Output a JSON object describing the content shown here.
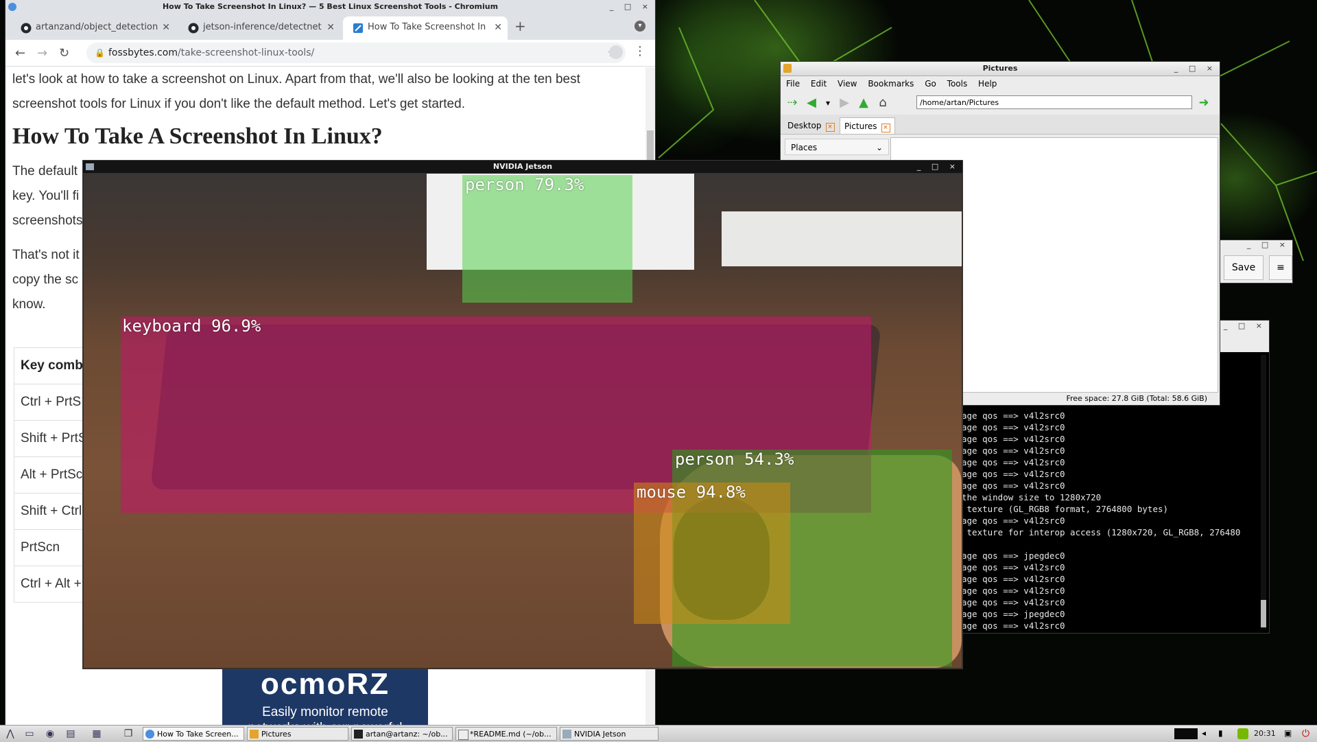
{
  "chromium": {
    "window_title": "How To Take Screenshot In Linux? — 5 Best Linux Screenshot Tools - Chromium",
    "tabs": [
      {
        "label": "artanzand/object_detection",
        "active": false
      },
      {
        "label": "jetson-inference/detectnet",
        "active": false
      },
      {
        "label": "How To Take Screenshot In",
        "active": true
      }
    ],
    "url_domain": "fossbytes.com",
    "url_path": "/take-screenshot-linux-tools/",
    "article": {
      "paragraph1": "let's look at how to take a screenshot on Linux. Apart from that, we'll also be looking at the ten best screenshot tools for Linux if you don't like the default method. Let's get started.",
      "heading": "How To Take A Screenshot In Linux?",
      "paragraph2_fragments": [
        "The default",
        "key. You'll fi",
        "screenshots"
      ],
      "paragraph3_fragments": [
        "That's not it",
        "copy the sc",
        "know."
      ],
      "table_header": "Key comb",
      "table_rows": [
        "Ctrl + PrtS",
        "Shift + PrtS",
        "Alt + PrtSc",
        "Shift + Ctrl",
        "PrtScn",
        "Ctrl + Alt +"
      ]
    },
    "ad": {
      "brand": "ocmoRZ",
      "line1": "Easily monitor remote",
      "line2": "networks with our powerful"
    }
  },
  "pictures": {
    "window_title": "Pictures",
    "menu": [
      "File",
      "Edit",
      "View",
      "Bookmarks",
      "Go",
      "Tools",
      "Help"
    ],
    "path": "/home/artan/Pictures",
    "tabs": [
      {
        "label": "Desktop"
      },
      {
        "label": "Pictures"
      }
    ],
    "places_label": "Places",
    "status": "Free space: 27.8 GiB (Total: 58.6 GiB)"
  },
  "editor": {
    "save_label": "Save",
    "menu_label": "≡"
  },
  "terminal": {
    "lines": [
      "age qos ==> v4l2src0",
      "age qos ==> v4l2src0",
      "age qos ==> v4l2src0",
      "age qos ==> v4l2src0",
      "age qos ==> v4l2src0",
      "age qos ==> v4l2src0",
      "age qos ==> v4l2src0",
      "the window size to 1280x720",
      " texture (GL_RGB8 format, 2764800 bytes)",
      "age qos ==> v4l2src0",
      " texture for interop access (1280x720, GL_RGB8, 276480",
      "",
      "age qos ==> jpegdec0",
      "age qos ==> v4l2src0",
      "age qos ==> v4l2src0",
      "age qos ==> v4l2src0",
      "age qos ==> v4l2src0",
      "age qos ==> jpegdec0",
      "age qos ==> v4l2src0"
    ]
  },
  "jetson": {
    "window_title": "NVIDIA Jetson",
    "detections": [
      {
        "label": "person 79.3%",
        "color": "#5ad250"
      },
      {
        "label": "keyboard 96.9%",
        "color": "#c8146e"
      },
      {
        "label": "person 54.3%",
        "color": "#2d9b1e"
      },
      {
        "label": "mouse 94.8%",
        "color": "#d28c14"
      }
    ]
  },
  "taskbar": {
    "items": [
      {
        "label": "How To Take Screen..."
      },
      {
        "label": "Pictures"
      },
      {
        "label": "artan@artanz: ~/ob..."
      },
      {
        "label": "*README.md (~/ob..."
      },
      {
        "label": "NVIDIA Jetson"
      }
    ],
    "clock": "20:31"
  },
  "colors": {
    "chrome_frame": "#dee1e6",
    "taskbar": "#d6d6d6",
    "terminal_bg": "#000000",
    "accent_green": "#76b900"
  }
}
